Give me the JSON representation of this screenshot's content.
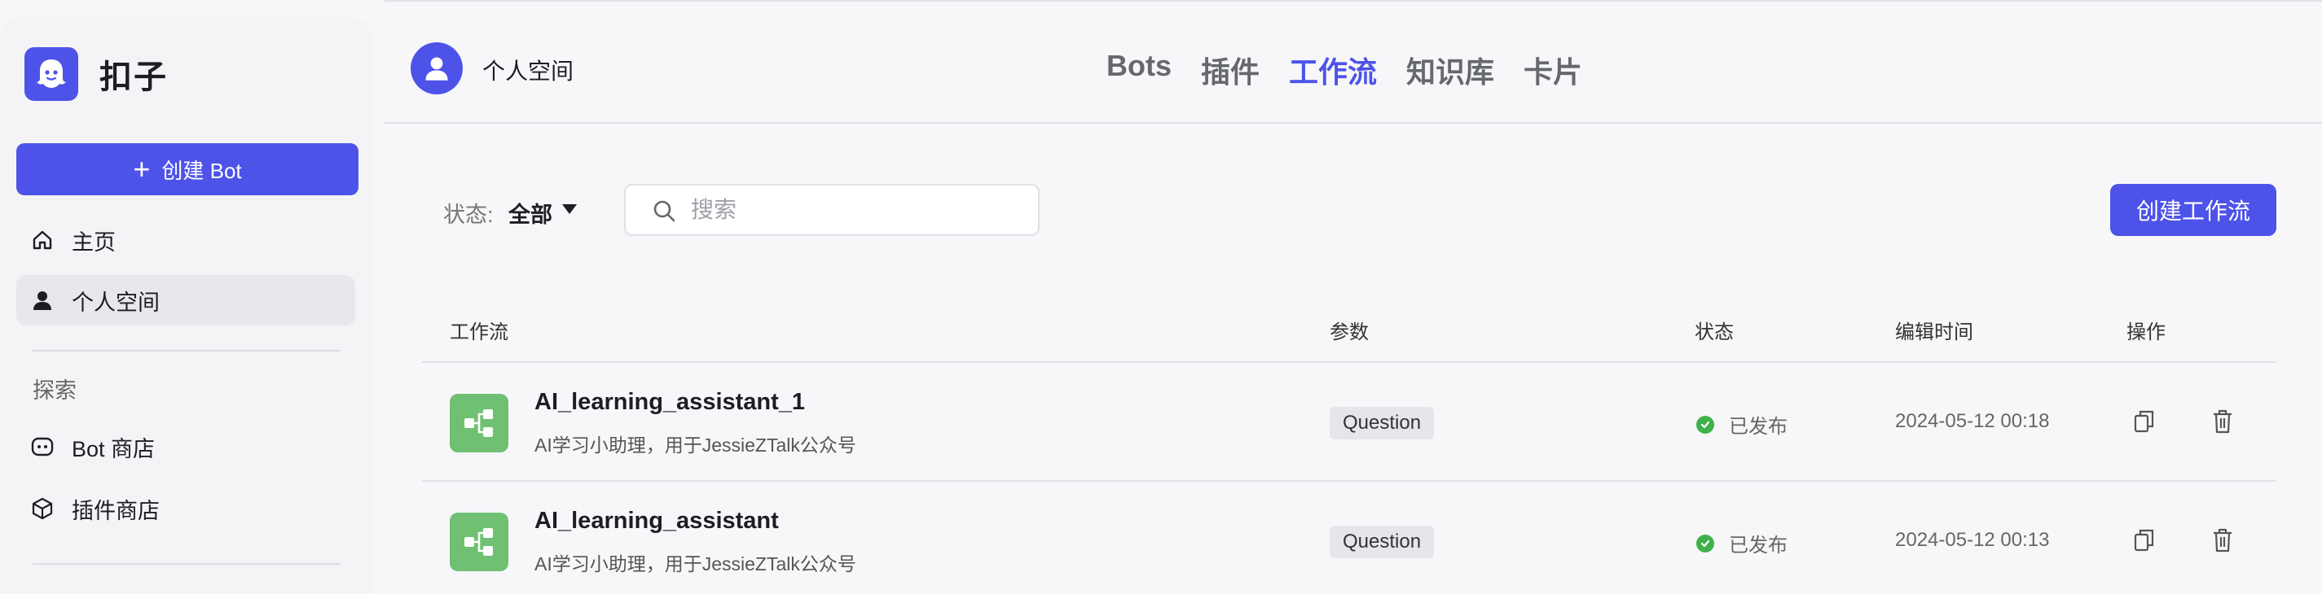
{
  "app": {
    "logo_text": "扣子",
    "create_bot_label": "创建 Bot",
    "nav": [
      {
        "label": "主页",
        "icon": "home-icon"
      },
      {
        "label": "个人空间",
        "icon": "user-icon",
        "active": true
      }
    ],
    "explore_label": "探索",
    "explore_items": [
      {
        "label": "Bot 商店",
        "icon": "bot-icon"
      },
      {
        "label": "插件商店",
        "icon": "cube-icon"
      }
    ],
    "brand_color": "#4d53e8"
  },
  "header": {
    "space_name": "个人空间",
    "tabs": [
      {
        "label": "Bots",
        "active": false
      },
      {
        "label": "插件",
        "active": false
      },
      {
        "label": "工作流",
        "active": true
      },
      {
        "label": "知识库",
        "active": false
      },
      {
        "label": "卡片",
        "active": false
      }
    ]
  },
  "toolbar": {
    "status_label": "状态:",
    "status_value": "全部",
    "search_placeholder": "搜索",
    "create_workflow_label": "创建工作流"
  },
  "table": {
    "columns": [
      "工作流",
      "参数",
      "状态",
      "编辑时间",
      "操作"
    ],
    "rows": [
      {
        "name": "AI_learning_assistant_1",
        "description": "AI学习小助理，用于JessieZTalk公众号",
        "param": "Question",
        "status": "已发布",
        "edited": "2024-05-12 00:18"
      },
      {
        "name": "AI_learning_assistant",
        "description": "AI学习小助理，用于JessieZTalk公众号",
        "param": "Question",
        "status": "已发布",
        "edited": "2024-05-12 00:13"
      }
    ]
  }
}
